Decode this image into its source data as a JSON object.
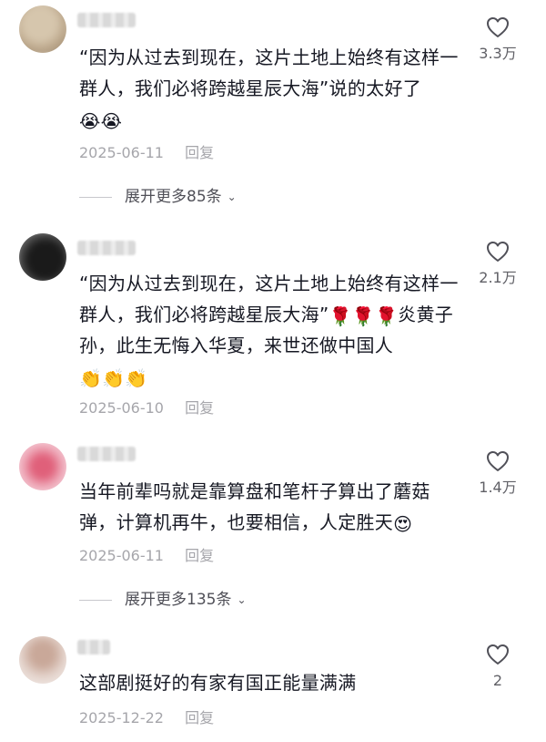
{
  "comments": [
    {
      "text": "“因为从过去到现在，这片土地上始终有这样一群人，我们必将跨越星辰大海”说的太好了",
      "emojis": "😭😭",
      "date": "2025-06-11",
      "reply": "回复",
      "likes": "3.3万",
      "avatar_color": "#cdbba0"
    },
    {
      "text": "“因为从过去到现在，这片土地上始终有这样一群人，我们必将跨越星辰大海”",
      "emojis": "🌹🌹🌹",
      "text2": "炎黄子孙，此生无悔入华夏，来世还做中国人",
      "emojis2": "👏👏👏",
      "date": "2025-06-10",
      "reply": "回复",
      "likes": "2.1万",
      "avatar_color": "#2a2a2a"
    },
    {
      "text": "当年前辈吗就是靠算盘和笔杆子算出了蘑菇弹，计算机再牛，也要相信，人定胜天",
      "emojis": "😍",
      "date": "2025-06-11",
      "reply": "回复",
      "likes": "1.4万",
      "avatar_color": "#e58fa3"
    },
    {
      "text": "这部剧挺好的有家有国正能量满满",
      "emojis": "",
      "date": "2025-12-22",
      "reply": "回复",
      "likes": "2",
      "avatar_color": "#d8c4bc"
    }
  ],
  "expand_1": "展开更多85条",
  "expand_2": "展开更多135条",
  "colors": {
    "text": "#161823",
    "meta": "#a6a6ab",
    "like_count": "#606066"
  }
}
